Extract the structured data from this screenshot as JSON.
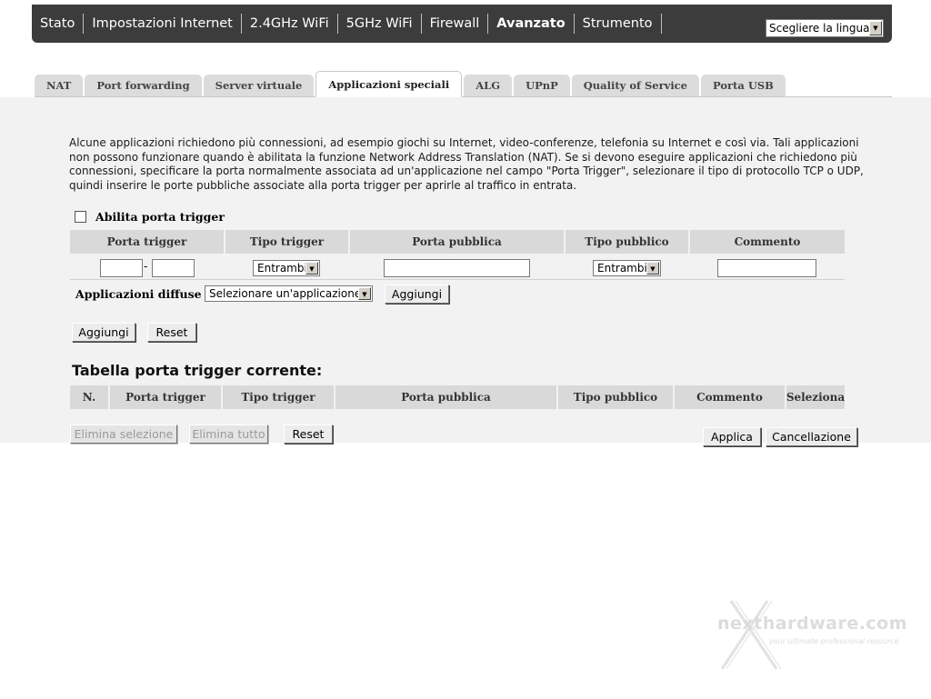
{
  "topnav": {
    "items": [
      "Stato",
      "Impostazioni Internet",
      "2.4GHz WiFi",
      "5GHz WiFi",
      "Firewall",
      "Avanzato",
      "Strumento"
    ],
    "active": "Avanzato",
    "language_select": "Scegliere la lingua"
  },
  "tabs": {
    "items": [
      "NAT",
      "Port forwarding",
      "Server virtuale",
      "Applicazioni speciali",
      "ALG",
      "UPnP",
      "Quality of Service",
      "Porta USB"
    ],
    "active": "Applicazioni speciali"
  },
  "description": "Alcune applicazioni richiedono più connessioni, ad esempio giochi su Internet, video-conferenze, telefonia su Internet e così via. Tali applicazioni non possono funzionare quando è abilitata la funzione Network Address Translation (NAT). Se si devono eseguire applicazioni che richiedono più connessioni, specificare la porta normalmente associata ad un'applicazione nel campo \"Porta Trigger\", selezionare il tipo di protocollo TCP o UDP, quindi inserire le porte pubbliche associate alla porta trigger per aprirle al traffico in entrata.",
  "form": {
    "enable_label": "Abilita porta trigger",
    "enable_checked": false,
    "columns": [
      "Porta trigger",
      "Tipo trigger",
      "Porta pubblica",
      "Tipo pubblico",
      "Commento"
    ],
    "trigger_from": "",
    "port_separator": "-",
    "trigger_to": "",
    "trigger_type": "Entrambi",
    "public_port": "",
    "public_type": "Entrambi",
    "comment": "",
    "apps_label": "Applicazioni diffuse :",
    "apps_select": "Selezionare un'applicazione",
    "apps_add_button": "Aggiungi",
    "add_button": "Aggiungi",
    "reset_button": "Reset"
  },
  "current_table": {
    "title": "Tabella porta trigger corrente:",
    "columns": [
      "N.",
      "Porta trigger",
      "Tipo trigger",
      "Porta pubblica",
      "Tipo pubblico",
      "Commento",
      "Seleziona"
    ],
    "rows": [],
    "delete_selected": "Elimina selezione",
    "delete_all": "Elimina tutto",
    "reset": "Reset"
  },
  "footer": {
    "apply": "Applica",
    "cancel": "Cancellazione"
  },
  "watermark": {
    "text": "nexthardware.com",
    "tagline": "your ultimate professional resource"
  }
}
